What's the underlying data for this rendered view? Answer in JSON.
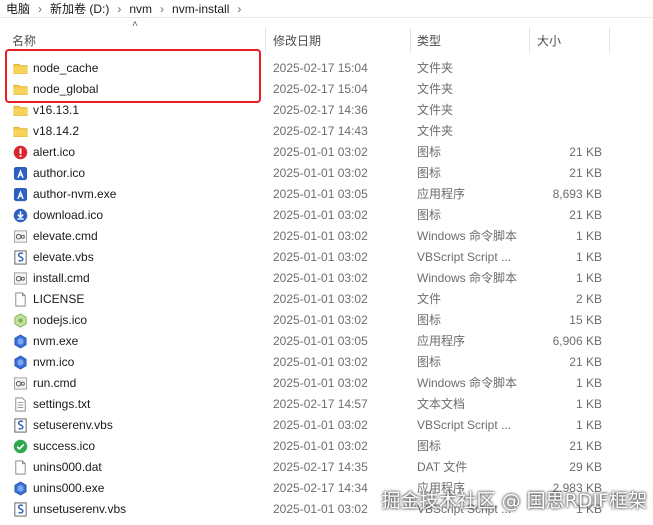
{
  "breadcrumb": {
    "items": [
      "电脑",
      "新加卷 (D:)",
      "nvm",
      "nvm-install"
    ],
    "separator": "›"
  },
  "header": {
    "name": "名称",
    "date": "修改日期",
    "type": "类型",
    "size": "大小",
    "sort_arrow": "˄"
  },
  "files": [
    {
      "name": "node_cache",
      "date": "2025-02-17 15:04",
      "type": "文件夹",
      "size": "",
      "icon": "folder-icon"
    },
    {
      "name": "node_global",
      "date": "2025-02-17 15:04",
      "type": "文件夹",
      "size": "",
      "icon": "folder-icon"
    },
    {
      "name": "v16.13.1",
      "date": "2025-02-17 14:36",
      "type": "文件夹",
      "size": "",
      "icon": "folder-icon"
    },
    {
      "name": "v18.14.2",
      "date": "2025-02-17 14:43",
      "type": "文件夹",
      "size": "",
      "icon": "folder-icon"
    },
    {
      "name": "alert.ico",
      "date": "2025-01-01 03:02",
      "type": "图标",
      "size": "21 KB",
      "icon": "alert-icon"
    },
    {
      "name": "author.ico",
      "date": "2025-01-01 03:02",
      "type": "图标",
      "size": "21 KB",
      "icon": "author-icon"
    },
    {
      "name": "author-nvm.exe",
      "date": "2025-01-01 03:05",
      "type": "应用程序",
      "size": "8,693 KB",
      "icon": "author-icon"
    },
    {
      "name": "download.ico",
      "date": "2025-01-01 03:02",
      "type": "图标",
      "size": "21 KB",
      "icon": "download-icon"
    },
    {
      "name": "elevate.cmd",
      "date": "2025-01-01 03:02",
      "type": "Windows 命令脚本",
      "size": "1 KB",
      "icon": "cmd-icon"
    },
    {
      "name": "elevate.vbs",
      "date": "2025-01-01 03:02",
      "type": "VBScript Script ...",
      "size": "1 KB",
      "icon": "vbs-icon"
    },
    {
      "name": "install.cmd",
      "date": "2025-01-01 03:02",
      "type": "Windows 命令脚本",
      "size": "1 KB",
      "icon": "cmd-icon"
    },
    {
      "name": "LICENSE",
      "date": "2025-01-01 03:02",
      "type": "文件",
      "size": "2 KB",
      "icon": "file-icon"
    },
    {
      "name": "nodejs.ico",
      "date": "2025-01-01 03:02",
      "type": "图标",
      "size": "15 KB",
      "icon": "nodejs-icon"
    },
    {
      "name": "nvm.exe",
      "date": "2025-01-01 03:05",
      "type": "应用程序",
      "size": "6,906 KB",
      "icon": "nvm-icon"
    },
    {
      "name": "nvm.ico",
      "date": "2025-01-01 03:02",
      "type": "图标",
      "size": "21 KB",
      "icon": "nvm-icon"
    },
    {
      "name": "run.cmd",
      "date": "2025-01-01 03:02",
      "type": "Windows 命令脚本",
      "size": "1 KB",
      "icon": "cmd-icon"
    },
    {
      "name": "settings.txt",
      "date": "2025-02-17 14:57",
      "type": "文本文档",
      "size": "1 KB",
      "icon": "text-file-icon"
    },
    {
      "name": "setuserenv.vbs",
      "date": "2025-01-01 03:02",
      "type": "VBScript Script ...",
      "size": "1 KB",
      "icon": "vbs-icon"
    },
    {
      "name": "success.ico",
      "date": "2025-01-01 03:02",
      "type": "图标",
      "size": "21 KB",
      "icon": "success-icon"
    },
    {
      "name": "unins000.dat",
      "date": "2025-02-17 14:35",
      "type": "DAT 文件",
      "size": "29 KB",
      "icon": "file-icon"
    },
    {
      "name": "unins000.exe",
      "date": "2025-02-17 14:34",
      "type": "应用程序",
      "size": "2,983 KB",
      "icon": "nvm-icon"
    },
    {
      "name": "unsetuserenv.vbs",
      "date": "2025-01-01 03:02",
      "type": "VBScript Script ...",
      "size": "1 KB",
      "icon": "vbs-icon"
    }
  ],
  "watermark": "掘金技术社区 @ 国思RDIF框架",
  "colors": {
    "highlight": "#ea1c1c",
    "folder": "#f5c842",
    "alert": "#d9262e",
    "blue": "#2c5fbf",
    "green": "#2fa84f",
    "nodejs": "#7cb342"
  }
}
